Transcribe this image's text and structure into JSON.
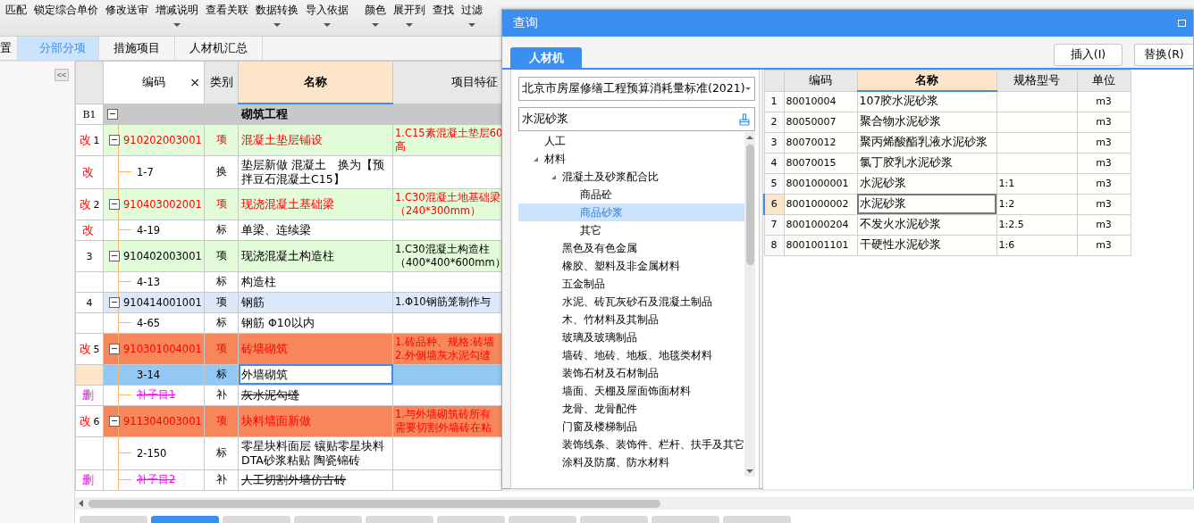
{
  "toolbar": [
    {
      "label": "匹配",
      "dropdown": false
    },
    {
      "label": "锁定综合单价",
      "dropdown": false
    },
    {
      "label": "修改送审",
      "dropdown": false
    },
    {
      "label": "增减说明",
      "dropdown": true
    },
    {
      "label": "查看关联",
      "dropdown": false
    },
    {
      "label": "数据转换",
      "dropdown": true
    },
    {
      "label": "导入依据",
      "dropdown": true
    },
    {
      "label": "颜色",
      "dropdown": true
    },
    {
      "label": "展开到",
      "dropdown": true
    },
    {
      "label": "查找",
      "dropdown": false
    },
    {
      "label": "过滤",
      "dropdown": true
    }
  ],
  "doc_tabs": [
    {
      "label": "置",
      "selected": false
    },
    {
      "label": "分部分项",
      "selected": true
    },
    {
      "label": "措施项目",
      "selected": false
    },
    {
      "label": "人材机汇总",
      "selected": false
    }
  ],
  "sidebar": {
    "collapse_button": "<<"
  },
  "table": {
    "filter_clear": "×",
    "columns": [
      {
        "label": "编码",
        "selected": false
      },
      {
        "label": "类别",
        "selected": false
      },
      {
        "label": "名称",
        "selected": true
      },
      {
        "label": "项目特征",
        "selected": false
      }
    ],
    "rows": [
      {
        "kind": "group",
        "mark": "B1",
        "flag": "",
        "modified": false,
        "deleted": false,
        "color": "#c8c8c8",
        "selected": false,
        "expanded": true,
        "code": "",
        "type": "",
        "name": "砌筑工程",
        "features": []
      },
      {
        "kind": "item",
        "mark": "1",
        "flag": "改",
        "modified": true,
        "deleted": false,
        "color": "#e2fbd9",
        "selected": false,
        "expanded": true,
        "code": "910202003001",
        "type": "项",
        "name": "混凝土垫层铺设",
        "features": [
          "1.C15素混凝土垫层60",
          "高"
        ]
      },
      {
        "kind": "sub",
        "mark": "",
        "flag": "改",
        "modified": true,
        "deleted": false,
        "color": "#ffffff",
        "selected": false,
        "code": "1-7",
        "type": "换",
        "name": "垫层新做 混凝土　换为【预拌豆石混凝土C15】",
        "features": []
      },
      {
        "kind": "item",
        "mark": "2",
        "flag": "改",
        "modified": true,
        "deleted": false,
        "color": "#e2fbd9",
        "selected": false,
        "expanded": true,
        "code": "910403002001",
        "type": "项",
        "name": "现浇混凝土基础梁",
        "features": [
          "1.C30混凝土地基础梁",
          "（240*300mm）"
        ]
      },
      {
        "kind": "sub",
        "mark": "",
        "flag": "改",
        "modified": true,
        "deleted": false,
        "color": "#ffffff",
        "selected": false,
        "code": "4-19",
        "type": "标",
        "name": "单梁、连续梁",
        "features": []
      },
      {
        "kind": "item",
        "mark": "3",
        "flag": "",
        "modified": false,
        "deleted": false,
        "color": "#e2fbd9",
        "selected": false,
        "expanded": true,
        "code": "910402003001",
        "type": "项",
        "name": "现浇混凝土构造柱",
        "features": [
          "1.C30混凝土构造柱",
          "（400*400*600mm）"
        ]
      },
      {
        "kind": "sub",
        "mark": "",
        "flag": "",
        "color": "#ffffff",
        "selected": false,
        "code": "4-13",
        "type": "标",
        "name": "构造柱",
        "features": []
      },
      {
        "kind": "item",
        "mark": "4",
        "flag": "",
        "modified": false,
        "deleted": false,
        "color": "#dce9fb",
        "selected": false,
        "expanded": true,
        "code": "910414001001",
        "type": "项",
        "name": "钢筋",
        "features": [
          "1.Φ10钢筋笼制作与"
        ]
      },
      {
        "kind": "sub",
        "mark": "",
        "flag": "",
        "color": "#ffffff",
        "selected": false,
        "code": "4-65",
        "type": "标",
        "name": "钢筋 Φ10以内",
        "features": []
      },
      {
        "kind": "item",
        "mark": "5",
        "flag": "改",
        "modified": true,
        "deleted": false,
        "color": "#f7865a",
        "selected": false,
        "expanded": true,
        "code": "910301004001",
        "type": "项",
        "name": "砖墙砌筑",
        "features": [
          "1.砖品种、规格:砖墙",
          "2.外侧墙灰水泥勾缝"
        ]
      },
      {
        "kind": "sub",
        "mark": "",
        "flag": "",
        "color": "#93c8f5",
        "selected": true,
        "code": "3-14",
        "type": "标",
        "name": "外墙砌筑",
        "features": []
      },
      {
        "kind": "sub",
        "mark": "",
        "flag": "删",
        "modified": false,
        "deleted": true,
        "color": "#ffffff",
        "selected": false,
        "code": "补子目1",
        "type": "补",
        "name": "灰水泥勾缝",
        "features": []
      },
      {
        "kind": "item",
        "mark": "6",
        "flag": "改",
        "modified": true,
        "deleted": false,
        "color": "#f7865a",
        "selected": false,
        "expanded": true,
        "code": "911304003001",
        "type": "项",
        "name": "块料墙面新做",
        "features": [
          "1.与外墙砌筑砖所有",
          "需要切割外墙砖在粘"
        ]
      },
      {
        "kind": "sub",
        "mark": "",
        "flag": "",
        "color": "#ffffff",
        "selected": false,
        "code": "2-150",
        "type": "标",
        "name": "零星块料面层 镶贴零星块料 DTA砂浆粘贴 陶瓷锦砖",
        "features": []
      },
      {
        "kind": "sub",
        "mark": "",
        "flag": "删",
        "modified": false,
        "deleted": true,
        "color": "#ffffff",
        "selected": false,
        "code": "补子目2",
        "type": "补",
        "name": "人工切割外墙仿古砖",
        "features": []
      }
    ]
  },
  "bottom_tabs": [
    {
      "selected": false
    },
    {
      "selected": true
    },
    {
      "selected": false
    },
    {
      "selected": false
    },
    {
      "selected": false
    },
    {
      "selected": false
    },
    {
      "selected": false
    },
    {
      "selected": false
    },
    {
      "selected": false
    },
    {
      "selected": false
    }
  ],
  "dialog": {
    "title": "查询",
    "tabs": [
      {
        "label": "人材机",
        "selected": true
      }
    ],
    "buttons": [
      "插入(I)",
      "替换(R)"
    ],
    "library": "北京市房屋修缮工程预算消耗量标准(2021)",
    "search": "水泥砂浆",
    "tree": [
      {
        "label": "人工",
        "selected": false
      },
      {
        "label": "材料",
        "selected": false,
        "expanded": true,
        "children": [
          {
            "label": "混凝土及砂浆配合比",
            "selected": false,
            "expanded": true,
            "children": [
              {
                "label": "商品砼",
                "selected": false
              },
              {
                "label": "商品砂浆",
                "selected": true
              },
              {
                "label": "其它",
                "selected": false
              }
            ]
          },
          {
            "label": "黑色及有色金属",
            "selected": false
          },
          {
            "label": "橡胶、塑料及非金属材料",
            "selected": false
          },
          {
            "label": "五金制品",
            "selected": false
          },
          {
            "label": "水泥、砖瓦灰砂石及混凝土制品",
            "selected": false
          },
          {
            "label": "木、竹材料及其制品",
            "selected": false
          },
          {
            "label": "玻璃及玻璃制品",
            "selected": false
          },
          {
            "label": "墙砖、地砖、地板、地毯类材料",
            "selected": false
          },
          {
            "label": "装饰石材及石材制品",
            "selected": false
          },
          {
            "label": "墙面、天棚及屋面饰面材料",
            "selected": false
          },
          {
            "label": "龙骨、龙骨配件",
            "selected": false
          },
          {
            "label": "门窗及楼梯制品",
            "selected": false
          },
          {
            "label": "装饰线条、装饰件、栏杆、扶手及其它",
            "selected": false
          },
          {
            "label": "涂料及防腐、防水材料",
            "selected": false
          }
        ]
      }
    ],
    "grid": {
      "columns": [
        {
          "label": "编码",
          "selected": false
        },
        {
          "label": "名称",
          "selected": true
        },
        {
          "label": "规格型号",
          "selected": false
        },
        {
          "label": "单位",
          "selected": false
        }
      ],
      "rows": [
        {
          "index": "1",
          "code": "80010004",
          "name": "107胶水泥砂浆",
          "spec": "",
          "unit": "m3",
          "selected": false
        },
        {
          "index": "2",
          "code": "80050007",
          "name": "聚合物水泥砂浆",
          "spec": "",
          "unit": "m3",
          "selected": false
        },
        {
          "index": "3",
          "code": "80070012",
          "name": "聚丙烯酸酯乳液水泥砂浆",
          "spec": "",
          "unit": "m3",
          "selected": false
        },
        {
          "index": "4",
          "code": "80070015",
          "name": "氯丁胶乳水泥砂浆",
          "spec": "",
          "unit": "m3",
          "selected": false
        },
        {
          "index": "5",
          "code": "8001000001",
          "name": "水泥砂浆",
          "spec": "1:1",
          "unit": "m3",
          "selected": false
        },
        {
          "index": "6",
          "code": "8001000002",
          "name": "水泥砂浆",
          "spec": "1:2",
          "unit": "m3",
          "selected": true
        },
        {
          "index": "7",
          "code": "8001000204",
          "name": "不发火水泥砂浆",
          "spec": "1:2.5",
          "unit": "m3",
          "selected": false
        },
        {
          "index": "8",
          "code": "8001001101",
          "name": "干硬性水泥砂浆",
          "spec": "1:6",
          "unit": "m3",
          "selected": false
        }
      ]
    }
  }
}
